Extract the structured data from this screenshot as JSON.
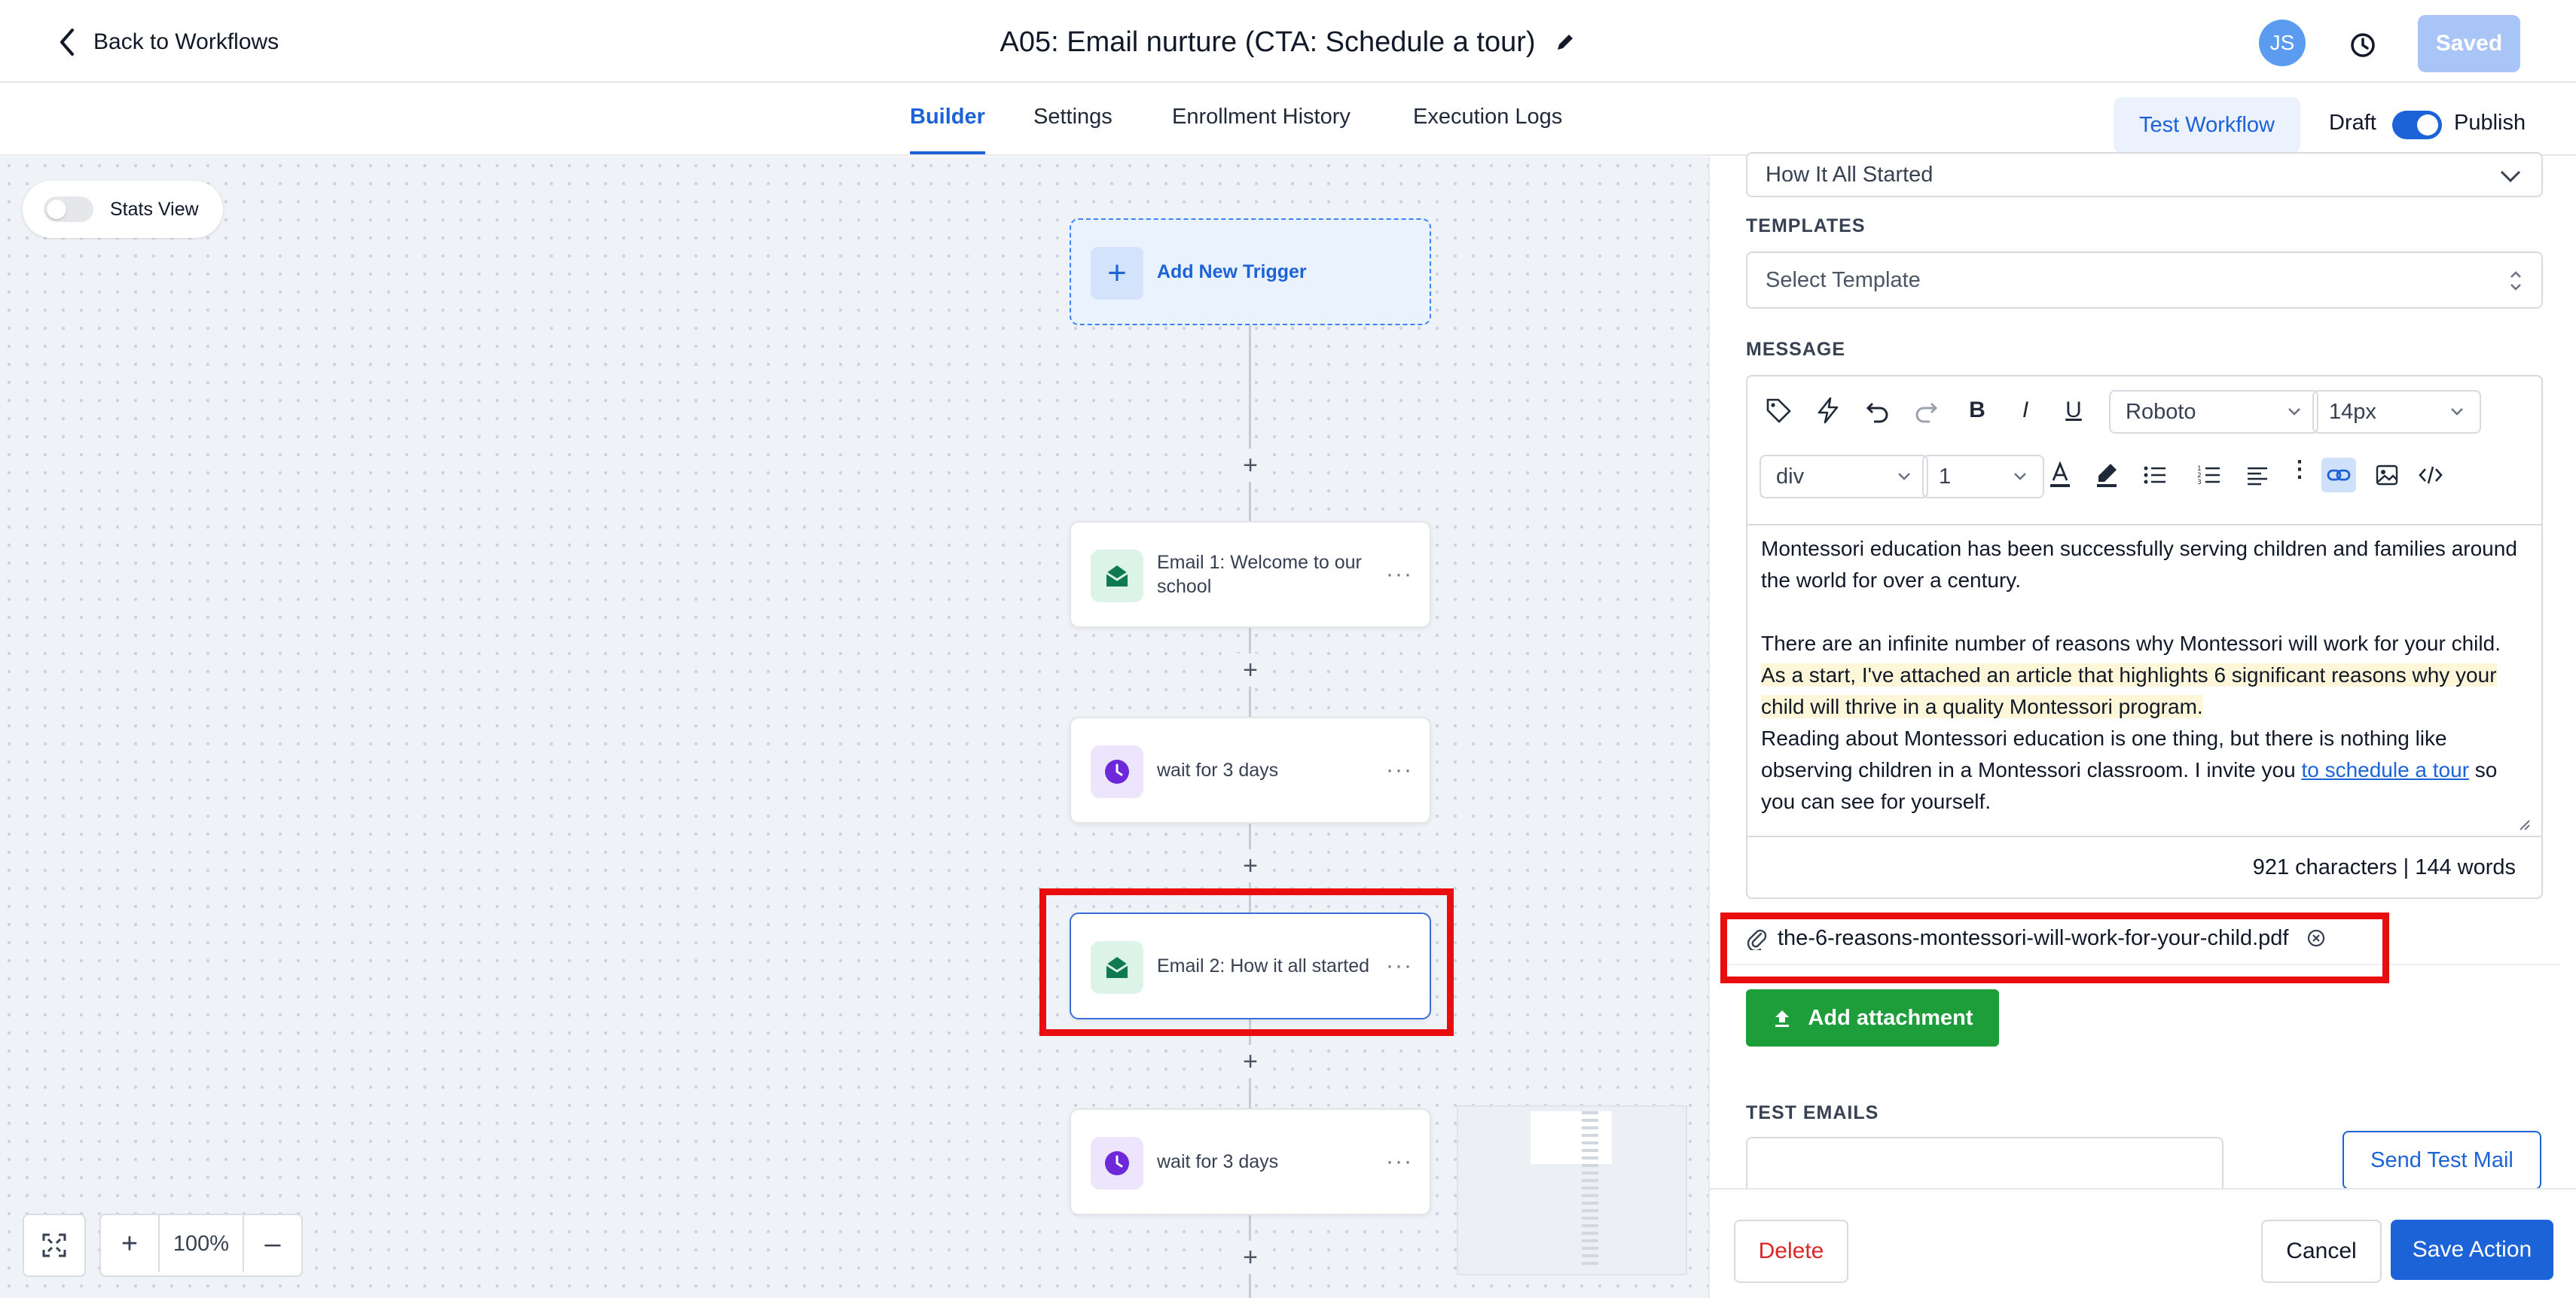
{
  "header": {
    "back_label": "Back to Workflows",
    "title": "A05: Email nurture (CTA: Schedule a tour)",
    "avatar_initials": "JS",
    "saved_label": "Saved"
  },
  "tabs": [
    {
      "label": "Builder",
      "active": true
    },
    {
      "label": "Settings",
      "active": false
    },
    {
      "label": "Enrollment History",
      "active": false
    },
    {
      "label": "Execution Logs",
      "active": false
    }
  ],
  "actions": {
    "test_workflow": "Test Workflow",
    "draft": "Draft",
    "publish": "Publish",
    "publish_enabled": true
  },
  "canvas": {
    "stats_view": "Stats View",
    "stats_view_enabled": false,
    "trigger_label": "Add New Trigger",
    "nodes": [
      {
        "label": "Email 1: Welcome to our school",
        "type": "email"
      },
      {
        "label": "wait for 3 days",
        "type": "wait"
      },
      {
        "label": "Email 2: How it all started",
        "type": "email"
      },
      {
        "label": "wait for 3 days",
        "type": "wait"
      }
    ],
    "zoom": "100%"
  },
  "panel": {
    "subject_value": "How It All Started",
    "templates_label": "TEMPLATES",
    "template_placeholder": "Select Template",
    "message_label": "MESSAGE",
    "font_family": "Roboto",
    "font_size": "14px",
    "block_type": "div",
    "line_height": "1",
    "body": {
      "p1": "Montessori education has been successfully serving children and families around the world for over a century.",
      "p2a": "There are an infinite number of reasons why Montessori will work for your child.",
      "p2b": "As a start, I've attached an article that highlights 6 significant reasons why your child will thrive in a quality Montessori program.",
      "p3a": "Reading about Montessori education is one thing, but there is nothing like observing children in a Montessori classroom. I invite you ",
      "p3link": "to schedule a tour",
      "p3b": " so you can see for yourself."
    },
    "counter": "921 characters | 144 words",
    "attachment": "the-6-reasons-montessori-will-work-for-your-child.pdf",
    "add_attachment": "Add attachment",
    "test_emails_label": "TEST EMAILS",
    "send_test": "Send Test Mail",
    "delete": "Delete",
    "cancel": "Cancel",
    "save_action": "Save Action"
  },
  "colors": {
    "accent": "#1d63d8",
    "success": "#1e9e3a",
    "danger": "#dc2626",
    "highlight": "#ea0d0d"
  }
}
